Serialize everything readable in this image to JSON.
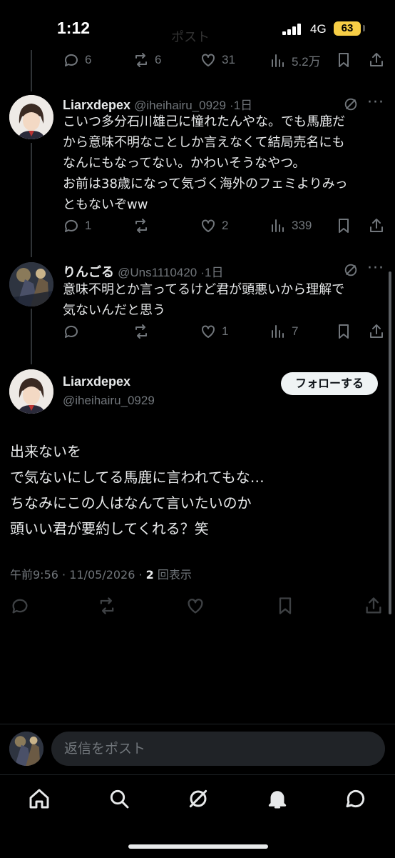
{
  "status": {
    "time": "1:12",
    "ghost_title": "ポスト",
    "network": "4G",
    "battery": "63"
  },
  "top_actions": {
    "replies": "6",
    "reposts": "6",
    "likes": "31",
    "views": "5.2万"
  },
  "post1": {
    "name": "Liarxdepex",
    "handle": "@iheihairu_0929",
    "age": "·1日",
    "text": "こいつ多分石川雄己に憧れたんやな。でも馬鹿だ\nから意味不明なことしか言えなくて結局売名にも\nなんにもなってない。かわいそうなやつ。\nお前は38歳になって気づく海外のフェミよりみっ\nともないぞww",
    "replies": "1",
    "reposts": "",
    "likes": "2",
    "views": "339"
  },
  "post2": {
    "name": "りんごる",
    "handle": "@Uns1110420",
    "age": "·1日",
    "text": "意味不明とか言ってるけど君が頭悪いから理解で\n気ないんだと思う",
    "replies": "",
    "reposts": "",
    "likes": "1",
    "views": "7"
  },
  "main_post": {
    "name": "Liarxdepex",
    "handle": "@iheihairu_0929",
    "follow_label": "フォローする",
    "text": "出来ないを\nで気ないにしてる馬鹿に言われてもな…\nちなみにこの人はなんて言いたいのか\n頭いい君が要約してくれる？笑",
    "timestamp": "午前9:56 · 11/05/2026 · ",
    "views_count": "2",
    "views_label": " 回表示"
  },
  "reply_box": {
    "placeholder": "返信をポスト"
  },
  "more_label": "···",
  "icons": [
    "reply-icon",
    "repost-icon",
    "like-icon",
    "views-icon",
    "bookmark-icon",
    "share-icon",
    "grok-icon",
    "home-icon",
    "search-icon",
    "notifications-icon",
    "messages-icon"
  ]
}
